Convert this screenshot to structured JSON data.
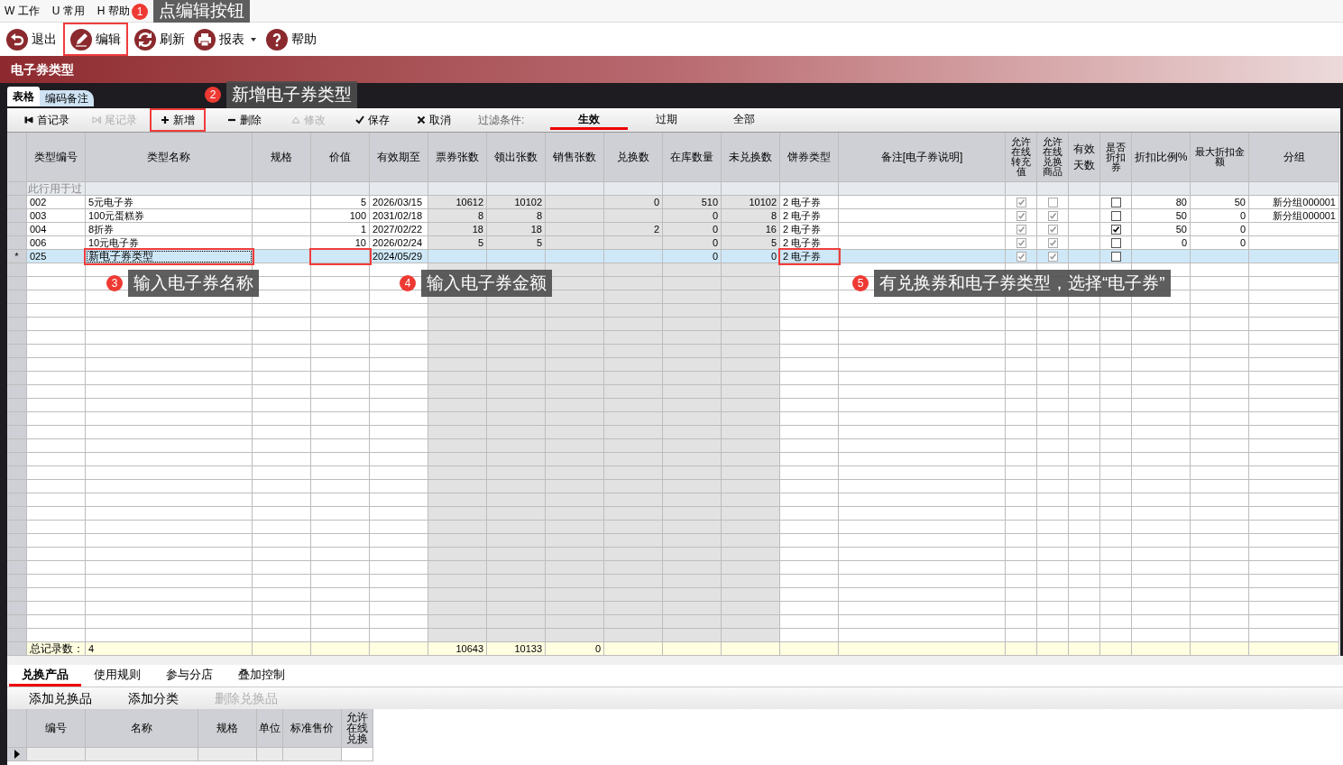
{
  "menu": [
    {
      "label": "W 工作"
    },
    {
      "label": "U 常用"
    },
    {
      "label": "H 帮助"
    }
  ],
  "toolbar": [
    {
      "label": "退出",
      "dropdown": false,
      "highlighted": false
    },
    {
      "label": "编辑",
      "dropdown": false,
      "highlighted": true
    },
    {
      "label": "刷新",
      "dropdown": false,
      "highlighted": false
    },
    {
      "label": "报表",
      "dropdown": true,
      "highlighted": false
    },
    {
      "label": "帮助",
      "dropdown": false,
      "highlighted": false
    }
  ],
  "panel_title": "电子券类型",
  "tabs": [
    {
      "label": "表格",
      "selected": true
    },
    {
      "label": "编码备注",
      "selected": false
    }
  ],
  "record_toolbar": [
    {
      "label": "首记录",
      "disabled": false,
      "highlighted": false
    },
    {
      "label": "尾记录",
      "disabled": true,
      "highlighted": false
    },
    {
      "label": "新增",
      "disabled": false,
      "highlighted": true
    },
    {
      "label": "删除",
      "disabled": false,
      "highlighted": false
    },
    {
      "label": "修改",
      "disabled": true,
      "highlighted": false
    },
    {
      "label": "保存",
      "disabled": false,
      "highlighted": false
    },
    {
      "label": "取消",
      "disabled": false,
      "highlighted": false
    }
  ],
  "filter": {
    "label": "过滤条件:",
    "options": [
      {
        "label": "生效",
        "selected": true
      },
      {
        "label": "过期",
        "selected": false
      },
      {
        "label": "全部",
        "selected": false
      }
    ]
  },
  "table": {
    "columns": [
      {
        "label": "类型编号",
        "kind": "left",
        "readonly": false
      },
      {
        "label": "类型名称",
        "kind": "left",
        "readonly": false
      },
      {
        "label": "规格",
        "kind": "left",
        "readonly": false
      },
      {
        "label": "价值",
        "kind": "right",
        "readonly": false
      },
      {
        "label": "有效期至",
        "kind": "left",
        "readonly": false
      },
      {
        "label": "票券张数",
        "kind": "right",
        "readonly": true
      },
      {
        "label": "领出张数",
        "kind": "right",
        "readonly": true
      },
      {
        "label": "销售张数",
        "kind": "right",
        "readonly": true
      },
      {
        "label": "兑换数",
        "kind": "right",
        "readonly": true
      },
      {
        "label": "在库数量",
        "kind": "right",
        "readonly": true
      },
      {
        "label": "未兑换数",
        "kind": "right",
        "readonly": true
      },
      {
        "label": "饼券类型",
        "kind": "left",
        "readonly": false
      },
      {
        "label": "备注[电子券说明]",
        "kind": "left",
        "readonly": false
      },
      {
        "label": "允许在线转充值",
        "kind": "checkbox",
        "readonly": true
      },
      {
        "label": "允许在线兑换商品",
        "kind": "checkbox",
        "readonly": true
      },
      {
        "label": "有效天数",
        "kind": "right",
        "readonly": false
      },
      {
        "label": "是否折扣券",
        "kind": "checkbox",
        "readonly": false
      },
      {
        "label": "折扣比例%",
        "kind": "right",
        "readonly": false
      },
      {
        "label": "最大折扣金额",
        "kind": "right",
        "readonly": false
      },
      {
        "label": "分组",
        "kind": "right",
        "readonly": false
      }
    ],
    "filter_row_hint": "此行用于过",
    "rows": [
      {
        "selected": false,
        "editing": false,
        "type_code": "002",
        "type_name": "5元电子券",
        "value": "5",
        "valid_until": "2026/03/15",
        "ticket_count": "10612",
        "issued_count": "10102",
        "redeemed_count": "0",
        "stock_qty": "510",
        "unredeemed_count": "10102",
        "voucher_type": "2 电子券",
        "allow_online_recharge": true,
        "allow_online_redeem": false,
        "is_discount": false,
        "discount_percent": "80",
        "max_discount": "50",
        "group": "新分组000001"
      },
      {
        "selected": false,
        "editing": false,
        "type_code": "003",
        "type_name": "100元蛋糕券",
        "value": "100",
        "valid_until": "2031/02/18",
        "ticket_count": "8",
        "issued_count": "8",
        "stock_qty": "0",
        "unredeemed_count": "8",
        "voucher_type": "2 电子券",
        "allow_online_recharge": true,
        "allow_online_redeem": true,
        "is_discount": false,
        "discount_percent": "50",
        "max_discount": "0",
        "group": "新分组000001"
      },
      {
        "selected": false,
        "editing": false,
        "type_code": "004",
        "type_name": "8折券",
        "value": "1",
        "valid_until": "2027/02/22",
        "ticket_count": "18",
        "issued_count": "18",
        "redeemed_count": "2",
        "stock_qty": "0",
        "unredeemed_count": "16",
        "voucher_type": "2 电子券",
        "allow_online_recharge": true,
        "allow_online_redeem": true,
        "is_discount": true,
        "discount_percent": "50",
        "max_discount": "0"
      },
      {
        "selected": false,
        "editing": false,
        "type_code": "006",
        "type_name": "10元电子券",
        "value": "10",
        "valid_until": "2026/02/24",
        "ticket_count": "5",
        "issued_count": "5",
        "stock_qty": "0",
        "unredeemed_count": "5",
        "voucher_type": "2 电子券",
        "allow_online_recharge": true,
        "allow_online_redeem": true,
        "is_discount": false,
        "discount_percent": "0",
        "max_discount": "0"
      },
      {
        "marker": "*",
        "selected": true,
        "editing": true,
        "type_code": "025",
        "type_name": {
          "text": "新电子券类型",
          "highlighted": true
        },
        "value": {
          "highlighted": true
        },
        "valid_until": "2024/05/29",
        "stock_qty": "0",
        "unredeemed_count": "0",
        "voucher_type": {
          "text": "2 电子券",
          "highlighted": true
        },
        "allow_online_recharge": true,
        "allow_online_redeem": true,
        "is_discount": false
      }
    ],
    "total_row": {
      "label": "总记录数：",
      "count": "4",
      "ticket_count": "10643",
      "issued_count": "10133",
      "sold_count": "0"
    }
  },
  "detail_tabs": [
    {
      "label": "兑换产品",
      "selected": true
    },
    {
      "label": "使用规则",
      "selected": false
    },
    {
      "label": "参与分店",
      "selected": false
    },
    {
      "label": "叠加控制",
      "selected": false
    }
  ],
  "detail_actions": [
    {
      "label": "添加兑换品",
      "disabled": false
    },
    {
      "label": "添加分类",
      "disabled": false
    },
    {
      "label": "删除兑换品",
      "disabled": true
    }
  ],
  "detail_table": {
    "columns": [
      "编号",
      "名称",
      "规格",
      "单位",
      "标准售价",
      "允许在线兑换"
    ]
  },
  "annotations": [
    {
      "number": "1",
      "text": "点编辑按钮"
    },
    {
      "number": "2",
      "text": "新增电子券类型"
    },
    {
      "number": "3",
      "text": "输入电子券名称"
    },
    {
      "number": "4",
      "text": "输入电子券金额"
    },
    {
      "number": "5",
      "text": "有兑换券和电子券类型，选择“电子券”"
    }
  ]
}
